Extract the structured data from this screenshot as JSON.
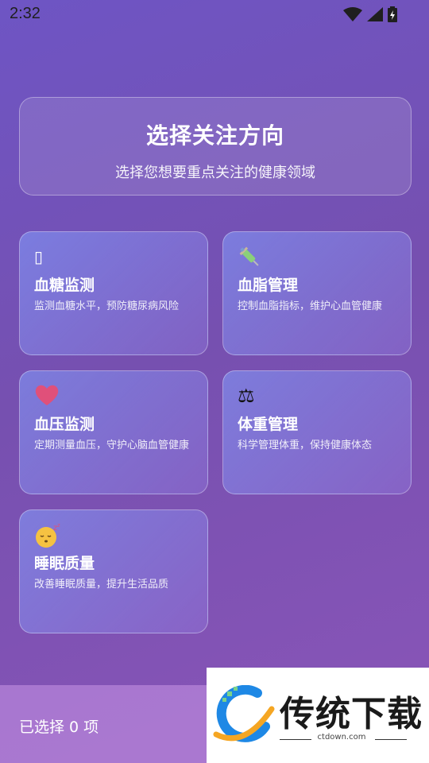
{
  "status": {
    "time": "2:32"
  },
  "header": {
    "title": "选择关注方向",
    "subtitle": "选择您想要重点关注的健康领域"
  },
  "options": [
    {
      "icon": "blood-drop-icon",
      "glyph": "▯",
      "title": "血糖监测",
      "desc": "监测血糖水平，预防糖尿病风险"
    },
    {
      "icon": "syringe-icon",
      "glyph": "💉",
      "title": "血脂管理",
      "desc": "控制血脂指标，维护心血管健康"
    },
    {
      "icon": "heart-icon",
      "glyph": "❤",
      "title": "血压监测",
      "desc": "定期测量血压，守护心脑血管健康"
    },
    {
      "icon": "scale-icon",
      "glyph": "⚖",
      "title": "体重管理",
      "desc": "科学管理体重，保持健康体态"
    },
    {
      "icon": "sleeping-face-icon",
      "glyph": "😴",
      "title": "睡眠质量",
      "desc": "改善睡眠质量，提升生活品质"
    }
  ],
  "footer": {
    "selected_text": "已选择 0 项"
  },
  "watermark": {
    "brand": "传统下载",
    "url": "ctdown.com"
  },
  "colors": {
    "heart": "#e0507a",
    "syringe": "#8bd07a"
  }
}
